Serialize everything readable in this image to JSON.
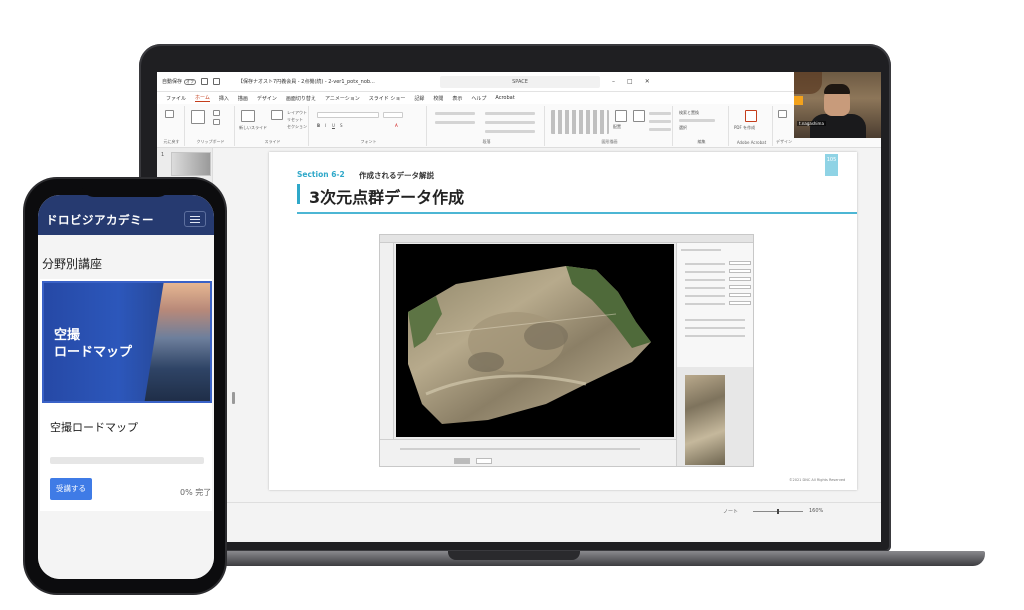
{
  "laptop": {
    "titlebar": {
      "autosave_label": "自動保存",
      "autosave_state": "オフ",
      "doc_name": "【保存ナオスト7円義会員 - 2点機(続) - 2-ver1_potx_nob...",
      "search_text": "SPACE"
    },
    "menu_tabs": [
      "ファイル",
      "ホーム",
      "挿入",
      "描画",
      "デザイン",
      "画面切り替え",
      "アニメーション",
      "スライド ショー",
      "記録",
      "校閲",
      "表示",
      "ヘルプ",
      "Acrobat"
    ],
    "active_tab_index": 1,
    "ribbon_groups": [
      "元に戻す",
      "クリップボード",
      "スライド",
      "フォント",
      "段落",
      "図形描画",
      "編集",
      "Adobe Acrobat",
      "デザイン"
    ],
    "ribbon_labels": {
      "new_slide": "新しいスライド",
      "reuse_slide": "スライドの再利用",
      "layout": "レイアウト",
      "reset": "リセット",
      "section": "セクション",
      "arrange": "配置",
      "quick_style": "クイック スタイル",
      "find": "検索と置換",
      "select": "選択",
      "pdf": "PDF を作成",
      "dictate": "ディクテーション"
    },
    "webcam_name": "t.nagashima",
    "slide_number": "1",
    "slide": {
      "section_label": "Section 6-2",
      "section_desc": "作成されるデータ解説",
      "title": "3次元点群データ作成",
      "page_num": "105",
      "copyright": "©2021 DNC All Rights Reserved"
    },
    "statusbar": {
      "notes": "ノート",
      "zoom": "160%"
    }
  },
  "phone": {
    "logo": "ドロビジアカデミー",
    "section_title": "分野別講座",
    "card": {
      "image_caption": "空撮\nロードマップ",
      "course_name": "空撮ロードマップ",
      "progress": 0,
      "enroll_label": "受講する",
      "progress_text": "0% 完了"
    }
  },
  "colors": {
    "accent_cyan": "#2fa8c9",
    "phone_header": "#263a70",
    "button_blue": "#3f7be6",
    "powerpoint_red": "#c43e1c"
  }
}
